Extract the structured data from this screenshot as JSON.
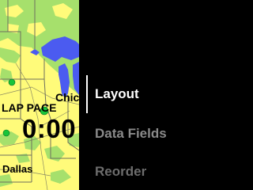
{
  "map": {
    "cities": {
      "chicago": "Chic",
      "dallas": "Dallas"
    },
    "data_field": {
      "label": "LAP PACE",
      "value": "0:00"
    },
    "colors": {
      "land": "#fffb7a",
      "forest": "#a6e06c",
      "water": "#4b5bf0",
      "marker": "#18c43a",
      "border": "#6f6f5e"
    }
  },
  "menu": {
    "items": [
      {
        "label": "Layout"
      },
      {
        "label": "Data Fields"
      },
      {
        "label": "Reorder"
      }
    ]
  }
}
